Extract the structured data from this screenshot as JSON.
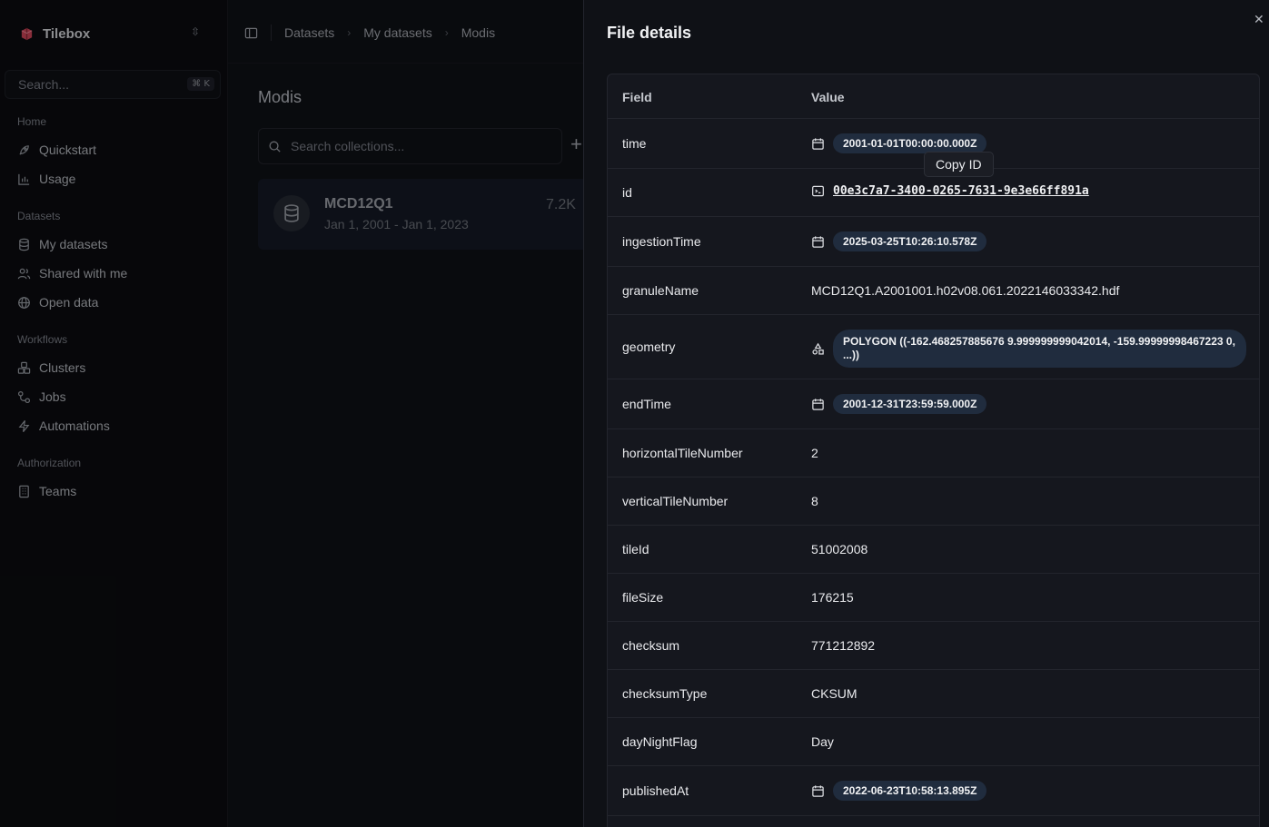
{
  "app": {
    "name": "Tilebox"
  },
  "sidebar": {
    "search_placeholder": "Search...",
    "search_shortcut": "⌘ K",
    "groups": {
      "home": "Home",
      "datasets": "Datasets",
      "workflows": "Workflows",
      "authorization": "Authorization"
    },
    "items": {
      "quickstart": "Quickstart",
      "usage": "Usage",
      "my_datasets": "My datasets",
      "shared": "Shared with me",
      "open_data": "Open data",
      "clusters": "Clusters",
      "jobs": "Jobs",
      "automations": "Automations",
      "teams": "Teams"
    }
  },
  "breadcrumb": [
    "Datasets",
    "My datasets",
    "Modis"
  ],
  "main": {
    "title": "Modis",
    "search_placeholder": "Search collections...",
    "collection": {
      "name": "MCD12Q1",
      "range": "Jan 1, 2001 - Jan 1, 2023",
      "count": "7.2K"
    }
  },
  "panel": {
    "title": "File details",
    "headers": {
      "field": "Field",
      "value": "Value"
    },
    "tooltip": "Copy ID",
    "rows": [
      {
        "field": "time",
        "value": "2001-01-01T00:00:00.000Z"
      },
      {
        "field": "id",
        "value": "00e3c7a7-3400-0265-7631-9e3e66ff891a"
      },
      {
        "field": "ingestionTime",
        "value": "2025-03-25T10:26:10.578Z"
      },
      {
        "field": "granuleName",
        "value": "MCD12Q1.A2001001.h02v08.061.2022146033342.hdf"
      },
      {
        "field": "geometry",
        "value": "POLYGON ((-162.468257885676 9.999999999042014, -159.99999998467223 0, ...))"
      },
      {
        "field": "endTime",
        "value": "2001-12-31T23:59:59.000Z"
      },
      {
        "field": "horizontalTileNumber",
        "value": "2"
      },
      {
        "field": "verticalTileNumber",
        "value": "8"
      },
      {
        "field": "tileId",
        "value": "51002008"
      },
      {
        "field": "fileSize",
        "value": "176215"
      },
      {
        "field": "checksum",
        "value": "771212892"
      },
      {
        "field": "checksumType",
        "value": "CKSUM"
      },
      {
        "field": "dayNightFlag",
        "value": "Day"
      },
      {
        "field": "publishedAt",
        "value": "2022-06-23T10:58:13.895Z"
      }
    ]
  },
  "colors": {
    "accent_pill": "#202c3e",
    "background": "#0f1116",
    "logo_red": "#d2455a"
  }
}
